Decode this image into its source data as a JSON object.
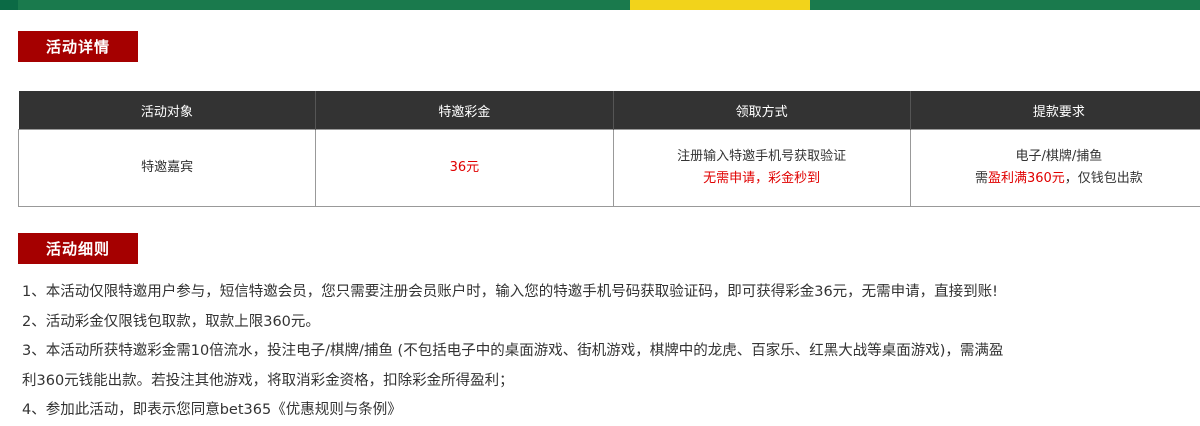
{
  "details_title": "活动详情",
  "rules_title": "活动细则",
  "table": {
    "headers": [
      "活动对象",
      "特邀彩金",
      "领取方式",
      "提款要求"
    ],
    "row": {
      "target": "特邀嘉宾",
      "bonus": "36元",
      "method_line1": "注册输入特邀手机号获取验证",
      "method_line2": "无需申请，彩金秒到",
      "withdraw_line1": "电子/棋牌/捕鱼",
      "withdraw_prefix": "需",
      "withdraw_highlight": "盈利满360元",
      "withdraw_suffix": "，仅钱包出款"
    }
  },
  "rules": [
    "1、本活动仅限特邀用户参与，短信特邀会员，您只需要注册会员账户时，输入您的特邀手机号码获取验证码，即可获得彩金36元，无需申请，直接到账!",
    "2、活动彩金仅限钱包取款，取款上限360元。",
    "3、本活动所获特邀彩金需10倍流水，投注电子/棋牌/捕鱼 (不包括电子中的桌面游戏、街机游戏，棋牌中的龙虎、百家乐、红黑大战等桌面游戏)，需满盈",
    "利360元钱能出款。若投注其他游戏，将取消彩金资格，扣除彩金所得盈利；",
    "4、参加此活动，即表示您同意bet365《优惠规则与条例》"
  ],
  "colors": {
    "accent_red": "#a50000",
    "header_dark": "#333333",
    "highlight_red": "#e00000",
    "banner_green": "#1a7a4d",
    "banner_yellow": "#f2d31b"
  }
}
